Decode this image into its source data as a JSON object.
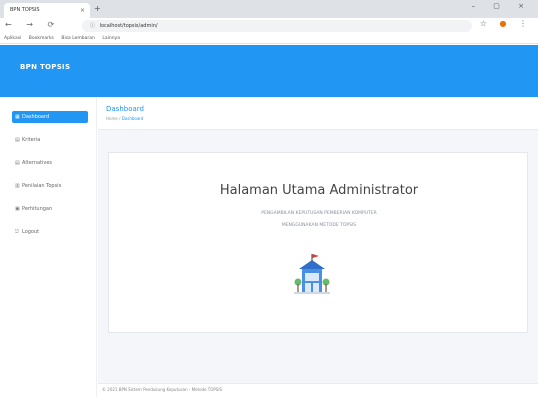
{
  "browser": {
    "tab_title": "BPN TOPSIS",
    "tab_close": "×",
    "new_tab": "+",
    "window_controls": "– ▢ ×",
    "nav_buttons": "← → ⟳",
    "url": "localhost/topsis/admin/",
    "url_prefix": "ⓘ",
    "bookmark_star": "☆",
    "extension_icon": "●",
    "menu_icon": "⋮",
    "bookmarks": [
      "Aplikasi",
      "Bookmarks",
      "Bisa Lembaran",
      "Lainnya"
    ]
  },
  "app": {
    "brand": "BPN TOPSIS",
    "colors": {
      "primary": "#2196f3",
      "content_bg": "#f4f6f9"
    }
  },
  "sidebar": {
    "items": [
      {
        "label": "Dashboard",
        "icon": "dashboard-icon",
        "active": true
      },
      {
        "label": "Kriteria",
        "icon": "list-icon",
        "active": false
      },
      {
        "label": "Alternatives",
        "icon": "list-icon",
        "active": false
      },
      {
        "label": "Penilaian Topsis",
        "icon": "table-icon",
        "active": false
      },
      {
        "label": "Perhitungan",
        "icon": "calc-icon",
        "active": false
      },
      {
        "label": "Logout",
        "icon": "logout-icon",
        "active": false
      }
    ]
  },
  "page": {
    "title": "Dashboard",
    "breadcrumb_home": "Home",
    "breadcrumb_sep": " / ",
    "breadcrumb_current": "Dashboard"
  },
  "card": {
    "title": "Halaman Utama Administrator",
    "subtitle_line1": "PENGAMBILAN KEPUTUSAN PEMBERIAN KOMPUTER",
    "subtitle_line2": "MENGGUNAKAN METODE TOPSIS",
    "illustration": "building-illustration"
  },
  "footer": {
    "text": "© 2021 BPN Sistem Pendukung Keputusan - Metode TOPSIS"
  }
}
